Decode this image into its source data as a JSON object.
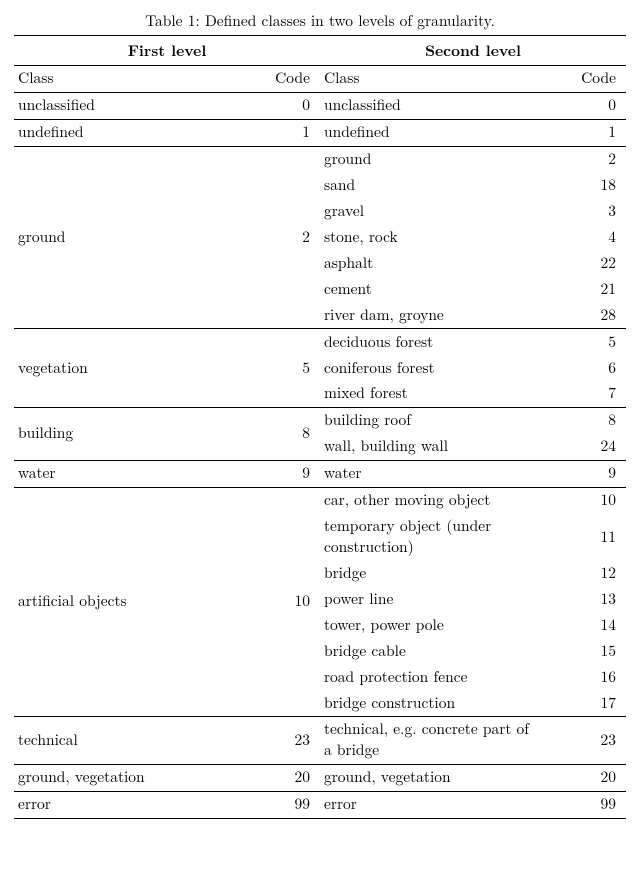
{
  "caption": "Table 1: Defined classes in two levels of granularity.",
  "headers": {
    "first": "First level",
    "second": "Second level",
    "class": "Class",
    "code": "Code"
  },
  "chart_data": {
    "type": "table",
    "title": "Defined classes in two levels of granularity.",
    "columns": [
      "First level Class",
      "First level Code",
      "Second level Class",
      "Second level Code"
    ],
    "groups": [
      {
        "first_class": "unclassified",
        "first_code": 0,
        "second": [
          {
            "class": "unclassified",
            "code": 0
          }
        ]
      },
      {
        "first_class": "undefined",
        "first_code": 1,
        "second": [
          {
            "class": "undefined",
            "code": 1
          }
        ]
      },
      {
        "first_class": "ground",
        "first_code": 2,
        "second": [
          {
            "class": "ground",
            "code": 2
          },
          {
            "class": "sand",
            "code": 18
          },
          {
            "class": "gravel",
            "code": 3
          },
          {
            "class": "stone, rock",
            "code": 4
          },
          {
            "class": "asphalt",
            "code": 22
          },
          {
            "class": "cement",
            "code": 21
          },
          {
            "class": "river dam, groyne",
            "code": 28
          }
        ]
      },
      {
        "first_class": "vegetation",
        "first_code": 5,
        "second": [
          {
            "class": "deciduous forest",
            "code": 5
          },
          {
            "class": "coniferous forest",
            "code": 6
          },
          {
            "class": "mixed forest",
            "code": 7
          }
        ]
      },
      {
        "first_class": "building",
        "first_code": 8,
        "second": [
          {
            "class": "building roof",
            "code": 8
          },
          {
            "class": "wall, building wall",
            "code": 24
          }
        ]
      },
      {
        "first_class": "water",
        "first_code": 9,
        "second": [
          {
            "class": "water",
            "code": 9
          }
        ]
      },
      {
        "first_class": "artificial objects",
        "first_code": 10,
        "second": [
          {
            "class": "car, other moving object",
            "code": 10
          },
          {
            "class": "temporary object (under construction)",
            "code": 11
          },
          {
            "class": "bridge",
            "code": 12
          },
          {
            "class": "power line",
            "code": 13
          },
          {
            "class": "tower, power pole",
            "code": 14
          },
          {
            "class": "bridge cable",
            "code": 15
          },
          {
            "class": "road protection fence",
            "code": 16
          },
          {
            "class": "bridge construction",
            "code": 17
          }
        ]
      },
      {
        "first_class": "technical",
        "first_code": 23,
        "second": [
          {
            "class": "technical, e.g. concrete part of a bridge",
            "code": 23
          }
        ]
      },
      {
        "first_class": "ground, vegetation",
        "first_code": 20,
        "second": [
          {
            "class": "ground, vegetation",
            "code": 20
          }
        ]
      },
      {
        "first_class": "error",
        "first_code": 99,
        "second": [
          {
            "class": "error",
            "code": 99
          }
        ]
      }
    ]
  }
}
